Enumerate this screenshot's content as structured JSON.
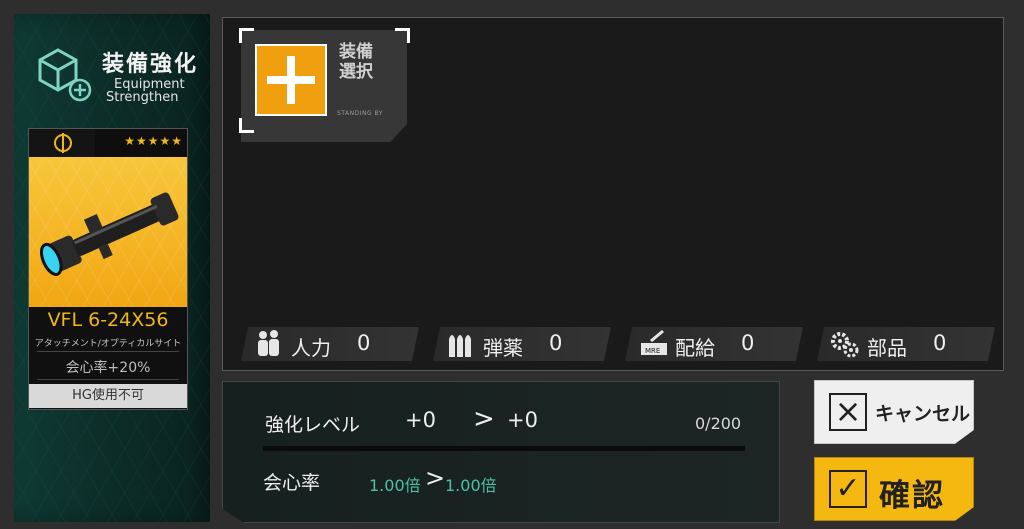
{
  "header": {
    "title_jp": "装備強化",
    "title_en_line1": "Equipment",
    "title_en_line2": "Strengthen"
  },
  "equipment_card": {
    "stars": "★★★★★",
    "rarity_stars": 5,
    "name": "VFL 6-24X56",
    "type": "アタッチメント/オプティカルサイト",
    "stat": "会心率+20%",
    "restriction": "HG使用不可",
    "colors": {
      "accent": "#f1b617",
      "background": "#f2a613"
    }
  },
  "slot": {
    "label": "装備\n選択",
    "label_line1": "装備",
    "label_line2": "選択",
    "status": "STANDING BY"
  },
  "resources": [
    {
      "icon": "manpower-icon",
      "label": "人力",
      "value": "0"
    },
    {
      "icon": "ammo-icon",
      "label": "弾薬",
      "value": "0"
    },
    {
      "icon": "ration-icon",
      "label": "配給",
      "value": "0"
    },
    {
      "icon": "parts-icon",
      "label": "部品",
      "value": "0"
    }
  ],
  "enhance": {
    "level_label": "強化レベル",
    "current_level": "+0",
    "arrow": ">",
    "next_level": "+0",
    "exp": "0/200",
    "crit_label": "会心率",
    "crit_current": "1.00倍",
    "crit_next": "1.00倍"
  },
  "buttons": {
    "cancel": "キャンセル",
    "confirm": "確認"
  }
}
